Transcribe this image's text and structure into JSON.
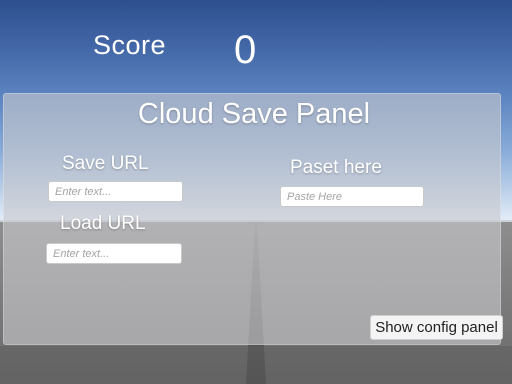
{
  "hud": {
    "score_label": "Score",
    "score_value": "0"
  },
  "panel": {
    "title": "Cloud Save Panel",
    "save_url": {
      "label": "Save URL",
      "placeholder": "Enter text...",
      "value": ""
    },
    "load_url": {
      "label": "Load URL",
      "placeholder": "Enter text...",
      "value": ""
    },
    "paste": {
      "label": "Paset here",
      "placeholder": "Paste Here",
      "value": ""
    },
    "config_button_label": "Show config panel"
  },
  "colors": {
    "sky_top": "#2d4f8e",
    "sky_horizon": "#e6eef8",
    "ground": "#7b7b7b",
    "panel_bg": "#c8c8cd",
    "text": "#ffffff"
  }
}
